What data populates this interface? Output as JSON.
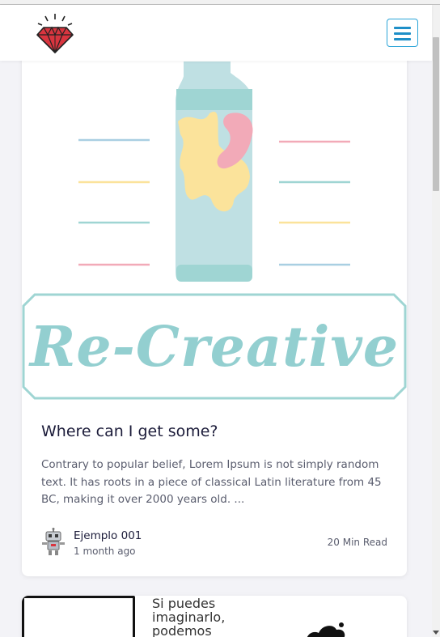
{
  "header": {
    "logo_icon": "ruby-gem-icon",
    "menu_icon": "hamburger-menu-icon",
    "colors": {
      "gem": "#d9353f",
      "menu_accent": "#1e8fc8"
    }
  },
  "post": {
    "image_text": "Re-Creative",
    "title": "Where can I get some?",
    "excerpt": "Contrary to popular belief, Lorem Ipsum is not simply random text. It has roots in a piece of classical Latin literature from 45 BC, making it over 2000 years old. ...",
    "author": "Ejemplo 001",
    "date": "1 month ago",
    "read_time": "20 Min Read",
    "avatar_icon": "robot-avatar-icon",
    "colors": {
      "teal": "#93cfd0",
      "yellow": "#fbe39b",
      "pink": "#f2aab8",
      "blue": "#a9cfe2"
    }
  },
  "next_post": {
    "quote_lines": [
      "Si puedes",
      "imaginarlo,",
      "podemos"
    ]
  }
}
